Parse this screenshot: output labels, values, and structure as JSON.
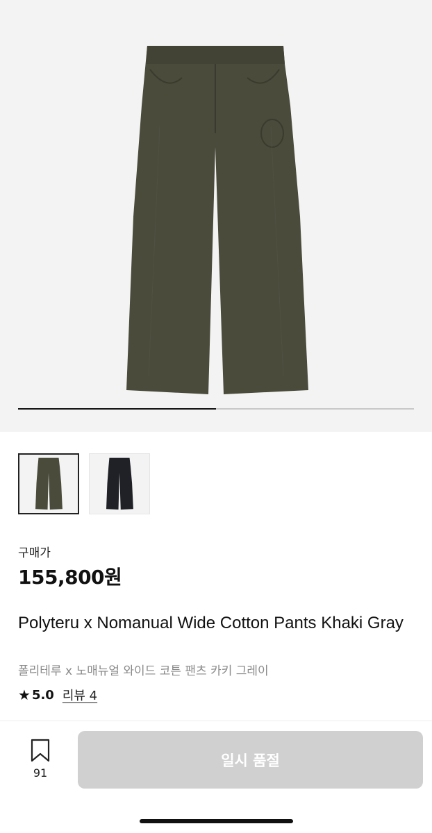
{
  "product": {
    "price_label": "구매가",
    "price": "155,800원",
    "title_en": "Polyteru x Nomanual Wide Cotton Pants Khaki Gray",
    "title_ko": "폴리테루 x 노매뉴얼 와이드 코튼 팬츠 카키 그레이",
    "rating": "5.0",
    "reviews": "리뷰 4"
  },
  "gallery": {
    "progress": 0.5,
    "thumbnails": [
      {
        "color": "khaki-gray",
        "selected": true
      },
      {
        "color": "black",
        "selected": false
      }
    ]
  },
  "actions": {
    "bookmark_count": "91",
    "buy_button_label": "일시 품절"
  },
  "icons": {
    "star": "star-icon",
    "bookmark": "bookmark-icon"
  },
  "colors": {
    "pants_main": "#4b4b3c",
    "pants_alt": "#1f2126",
    "disabled_button": "#d0d0d0"
  }
}
